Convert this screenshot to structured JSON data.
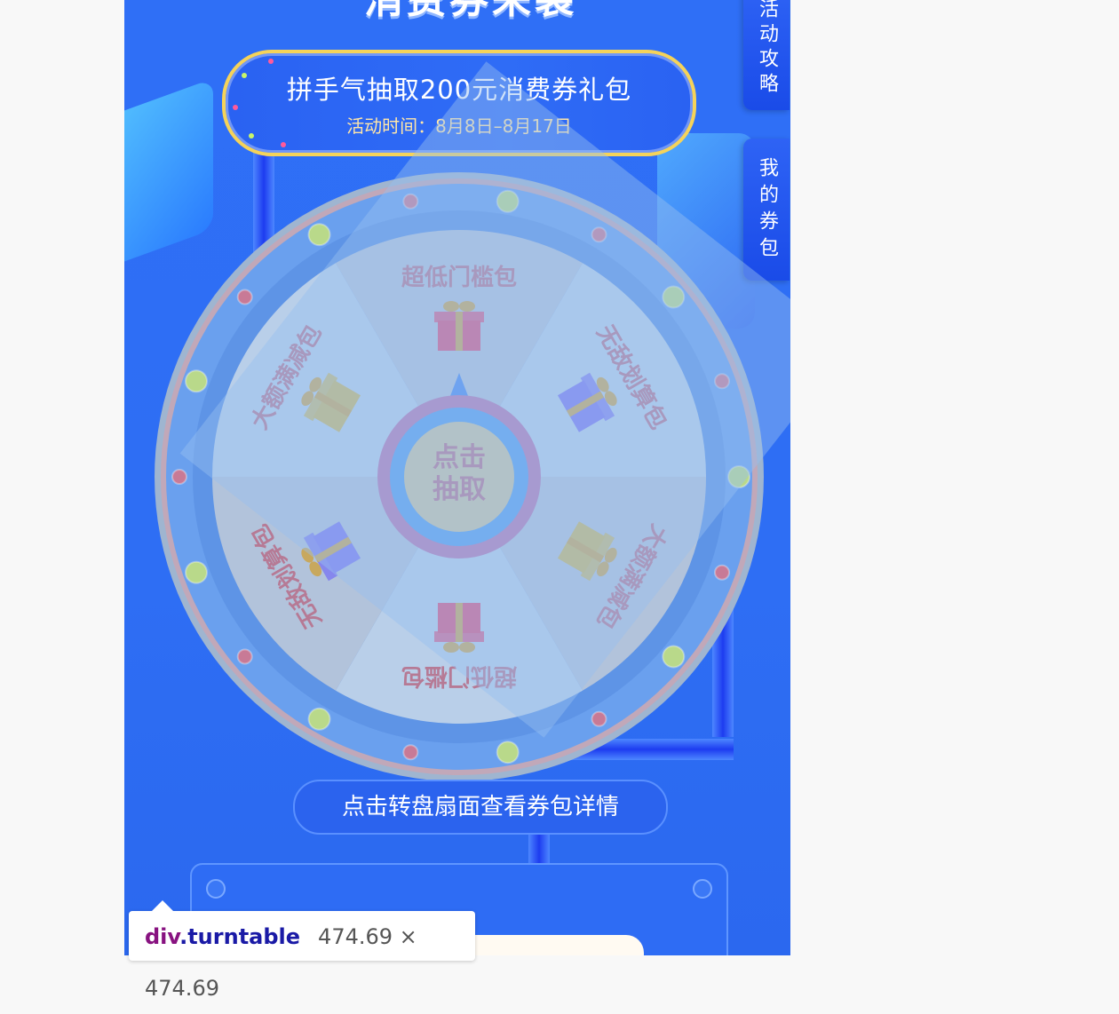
{
  "title_partial": "消费券来袭",
  "banner": {
    "main": "拼手气抽取200元消费券礼包",
    "sub": "活动时间：8月8日–8月17日"
  },
  "side_tabs": {
    "strategy": "活动攻略",
    "my_coupons": "我的券包"
  },
  "wheel": {
    "center_label": "点击抽取",
    "segments": [
      {
        "label": "超低门槛包",
        "gift_color": "#d85a86"
      },
      {
        "label": "无敌划算包",
        "gift_color": "#7e7df0"
      },
      {
        "label": "大额满减包",
        "gift_color": "#c9b96a"
      },
      {
        "label": "超低门槛包",
        "gift_color": "#d85a86"
      },
      {
        "label": "无敌划算包",
        "gift_color": "#7e7df0"
      },
      {
        "label": "大额满减包",
        "gift_color": "#c9b96a"
      }
    ]
  },
  "hint": "点击转盘扇面查看券包详情",
  "devtools": {
    "tag": "div",
    "class": ".turntable",
    "dims": "474.69 × 474.69"
  },
  "colors": {
    "bg": "#2f6ff6",
    "banner_border": "#f5d35a",
    "wheel_ring": "#6aa0ee",
    "segment_light": "#b9cfe9",
    "segment_dark": "#b2c3db",
    "label_color": "#b67a95"
  }
}
